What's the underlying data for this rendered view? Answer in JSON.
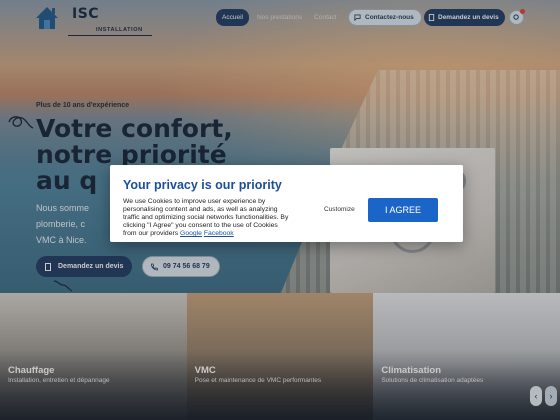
{
  "header": {
    "logo_title": "ISC",
    "logo_subtitle": "INSTALLATION",
    "nav": [
      {
        "label": "Accueil",
        "active": true
      },
      {
        "label": "Nos prestations",
        "active": false
      },
      {
        "label": "Contact",
        "active": false
      }
    ],
    "contact_label": "Contactez-nous",
    "quote_label": "Demandez un devis"
  },
  "hero": {
    "experience": "Plus de 10 ans d'expérience",
    "headline_line1": "Votre confort,",
    "headline_line2": "notre priorité",
    "headline_line3": "au q",
    "intro_line1": "Nous somme",
    "intro_line2": "plomberie, c",
    "intro_line3": "VMC à Nice.",
    "cta_label": "Demandez un devis",
    "phone": "09 74 56 68 79"
  },
  "cards": [
    {
      "title": "Chauffage",
      "description": "Installation, entretien et dépannage"
    },
    {
      "title": "VMC",
      "description": "Pose et maintenance de VMC performantes"
    },
    {
      "title": "Climatisation",
      "description": "Solutions de climatisation adaptées"
    }
  ],
  "carousel": {
    "prev": "‹",
    "next": "›"
  },
  "consent": {
    "title": "Your privacy is our priority",
    "text_before": "We use Cookies to improve user experience by personalising content and ads, as well as analyzing traffic and optimizing social networks functionalities. By clicking \"I Agree\" you consent to the use of Cookies from our providers ",
    "link_google": "Google",
    "link_separator": " ",
    "link_facebook": "Facebook",
    "customize_label": "Customize",
    "agree_label": "I AGREE"
  },
  "colors": {
    "primary": "#1f3a63",
    "consent_title": "#1b4f9b",
    "agree_button": "#1b65c9",
    "notification_dot": "#e63a3a"
  }
}
